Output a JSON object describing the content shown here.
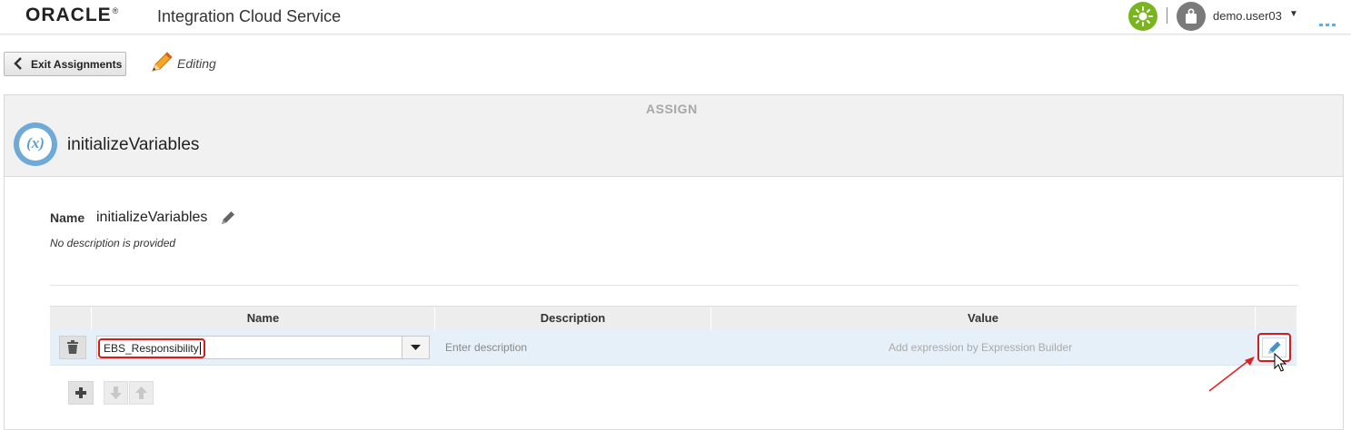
{
  "header": {
    "logo": "ORACLE",
    "product": "Integration Cloud Service",
    "user": "demo.user03",
    "colors": {
      "status": "#79b51f",
      "avatar": "#7a7a7a"
    },
    "icons": [
      "sun-icon",
      "user-icon",
      "caret-down-icon",
      "more-icon"
    ]
  },
  "toolbar": {
    "exit_label": "Exit Assignments",
    "mode_label": "Editing"
  },
  "panel": {
    "section_label": "ASSIGN",
    "title": "initializeVariables",
    "name_label": "Name",
    "name_value": "initializeVariables",
    "description_text": "No description is provided"
  },
  "table": {
    "columns": [
      "Name",
      "Description",
      "Value"
    ],
    "rows": [
      {
        "name": "EBS_Responsibility",
        "description_placeholder": "Enter description",
        "value_placeholder": "Add expression by Expression Builder"
      }
    ]
  },
  "colors": {
    "accent_blue": "#6ea9d8",
    "highlight_red": "#d71a1a",
    "row_selected": "#e6f0f8"
  }
}
